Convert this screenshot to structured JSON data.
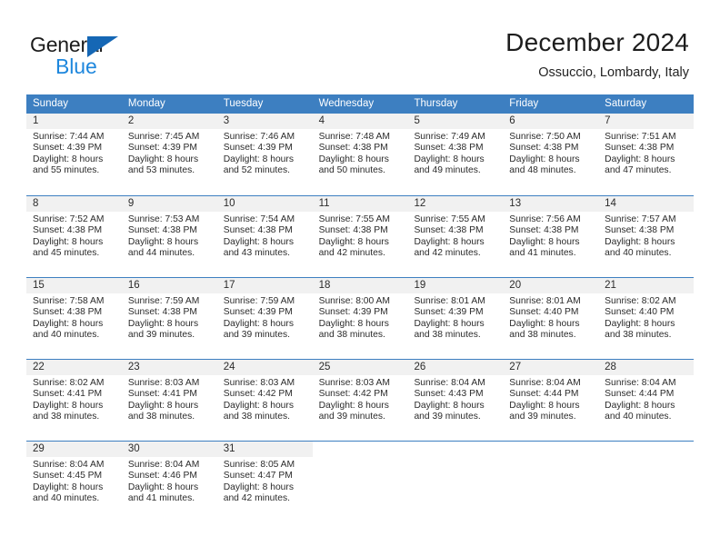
{
  "brand": {
    "name_part1": "General",
    "name_part2": "Blue",
    "triangle_color": "#1567b5",
    "blue_color": "#1e87dd"
  },
  "header": {
    "title": "December 2024",
    "subtitle": "Ossuccio, Lombardy, Italy"
  },
  "theme": {
    "header_row_bg": "#3d7fc1",
    "daynum_bg": "#f1f1f1",
    "grid_line": "#3d7fc1"
  },
  "calendar": {
    "day_names": [
      "Sunday",
      "Monday",
      "Tuesday",
      "Wednesday",
      "Thursday",
      "Friday",
      "Saturday"
    ],
    "weeks": [
      [
        {
          "day": "1",
          "line1": "Sunrise: 7:44 AM",
          "line2": "Sunset: 4:39 PM",
          "line3": "Daylight: 8 hours",
          "line4": "and 55 minutes."
        },
        {
          "day": "2",
          "line1": "Sunrise: 7:45 AM",
          "line2": "Sunset: 4:39 PM",
          "line3": "Daylight: 8 hours",
          "line4": "and 53 minutes."
        },
        {
          "day": "3",
          "line1": "Sunrise: 7:46 AM",
          "line2": "Sunset: 4:39 PM",
          "line3": "Daylight: 8 hours",
          "line4": "and 52 minutes."
        },
        {
          "day": "4",
          "line1": "Sunrise: 7:48 AM",
          "line2": "Sunset: 4:38 PM",
          "line3": "Daylight: 8 hours",
          "line4": "and 50 minutes."
        },
        {
          "day": "5",
          "line1": "Sunrise: 7:49 AM",
          "line2": "Sunset: 4:38 PM",
          "line3": "Daylight: 8 hours",
          "line4": "and 49 minutes."
        },
        {
          "day": "6",
          "line1": "Sunrise: 7:50 AM",
          "line2": "Sunset: 4:38 PM",
          "line3": "Daylight: 8 hours",
          "line4": "and 48 minutes."
        },
        {
          "day": "7",
          "line1": "Sunrise: 7:51 AM",
          "line2": "Sunset: 4:38 PM",
          "line3": "Daylight: 8 hours",
          "line4": "and 47 minutes."
        }
      ],
      [
        {
          "day": "8",
          "line1": "Sunrise: 7:52 AM",
          "line2": "Sunset: 4:38 PM",
          "line3": "Daylight: 8 hours",
          "line4": "and 45 minutes."
        },
        {
          "day": "9",
          "line1": "Sunrise: 7:53 AM",
          "line2": "Sunset: 4:38 PM",
          "line3": "Daylight: 8 hours",
          "line4": "and 44 minutes."
        },
        {
          "day": "10",
          "line1": "Sunrise: 7:54 AM",
          "line2": "Sunset: 4:38 PM",
          "line3": "Daylight: 8 hours",
          "line4": "and 43 minutes."
        },
        {
          "day": "11",
          "line1": "Sunrise: 7:55 AM",
          "line2": "Sunset: 4:38 PM",
          "line3": "Daylight: 8 hours",
          "line4": "and 42 minutes."
        },
        {
          "day": "12",
          "line1": "Sunrise: 7:55 AM",
          "line2": "Sunset: 4:38 PM",
          "line3": "Daylight: 8 hours",
          "line4": "and 42 minutes."
        },
        {
          "day": "13",
          "line1": "Sunrise: 7:56 AM",
          "line2": "Sunset: 4:38 PM",
          "line3": "Daylight: 8 hours",
          "line4": "and 41 minutes."
        },
        {
          "day": "14",
          "line1": "Sunrise: 7:57 AM",
          "line2": "Sunset: 4:38 PM",
          "line3": "Daylight: 8 hours",
          "line4": "and 40 minutes."
        }
      ],
      [
        {
          "day": "15",
          "line1": "Sunrise: 7:58 AM",
          "line2": "Sunset: 4:38 PM",
          "line3": "Daylight: 8 hours",
          "line4": "and 40 minutes."
        },
        {
          "day": "16",
          "line1": "Sunrise: 7:59 AM",
          "line2": "Sunset: 4:38 PM",
          "line3": "Daylight: 8 hours",
          "line4": "and 39 minutes."
        },
        {
          "day": "17",
          "line1": "Sunrise: 7:59 AM",
          "line2": "Sunset: 4:39 PM",
          "line3": "Daylight: 8 hours",
          "line4": "and 39 minutes."
        },
        {
          "day": "18",
          "line1": "Sunrise: 8:00 AM",
          "line2": "Sunset: 4:39 PM",
          "line3": "Daylight: 8 hours",
          "line4": "and 38 minutes."
        },
        {
          "day": "19",
          "line1": "Sunrise: 8:01 AM",
          "line2": "Sunset: 4:39 PM",
          "line3": "Daylight: 8 hours",
          "line4": "and 38 minutes."
        },
        {
          "day": "20",
          "line1": "Sunrise: 8:01 AM",
          "line2": "Sunset: 4:40 PM",
          "line3": "Daylight: 8 hours",
          "line4": "and 38 minutes."
        },
        {
          "day": "21",
          "line1": "Sunrise: 8:02 AM",
          "line2": "Sunset: 4:40 PM",
          "line3": "Daylight: 8 hours",
          "line4": "and 38 minutes."
        }
      ],
      [
        {
          "day": "22",
          "line1": "Sunrise: 8:02 AM",
          "line2": "Sunset: 4:41 PM",
          "line3": "Daylight: 8 hours",
          "line4": "and 38 minutes."
        },
        {
          "day": "23",
          "line1": "Sunrise: 8:03 AM",
          "line2": "Sunset: 4:41 PM",
          "line3": "Daylight: 8 hours",
          "line4": "and 38 minutes."
        },
        {
          "day": "24",
          "line1": "Sunrise: 8:03 AM",
          "line2": "Sunset: 4:42 PM",
          "line3": "Daylight: 8 hours",
          "line4": "and 38 minutes."
        },
        {
          "day": "25",
          "line1": "Sunrise: 8:03 AM",
          "line2": "Sunset: 4:42 PM",
          "line3": "Daylight: 8 hours",
          "line4": "and 39 minutes."
        },
        {
          "day": "26",
          "line1": "Sunrise: 8:04 AM",
          "line2": "Sunset: 4:43 PM",
          "line3": "Daylight: 8 hours",
          "line4": "and 39 minutes."
        },
        {
          "day": "27",
          "line1": "Sunrise: 8:04 AM",
          "line2": "Sunset: 4:44 PM",
          "line3": "Daylight: 8 hours",
          "line4": "and 39 minutes."
        },
        {
          "day": "28",
          "line1": "Sunrise: 8:04 AM",
          "line2": "Sunset: 4:44 PM",
          "line3": "Daylight: 8 hours",
          "line4": "and 40 minutes."
        }
      ],
      [
        {
          "day": "29",
          "line1": "Sunrise: 8:04 AM",
          "line2": "Sunset: 4:45 PM",
          "line3": "Daylight: 8 hours",
          "line4": "and 40 minutes."
        },
        {
          "day": "30",
          "line1": "Sunrise: 8:04 AM",
          "line2": "Sunset: 4:46 PM",
          "line3": "Daylight: 8 hours",
          "line4": "and 41 minutes."
        },
        {
          "day": "31",
          "line1": "Sunrise: 8:05 AM",
          "line2": "Sunset: 4:47 PM",
          "line3": "Daylight: 8 hours",
          "line4": "and 42 minutes."
        },
        {
          "day": "",
          "line1": "",
          "line2": "",
          "line3": "",
          "line4": ""
        },
        {
          "day": "",
          "line1": "",
          "line2": "",
          "line3": "",
          "line4": ""
        },
        {
          "day": "",
          "line1": "",
          "line2": "",
          "line3": "",
          "line4": ""
        },
        {
          "day": "",
          "line1": "",
          "line2": "",
          "line3": "",
          "line4": ""
        }
      ]
    ]
  }
}
